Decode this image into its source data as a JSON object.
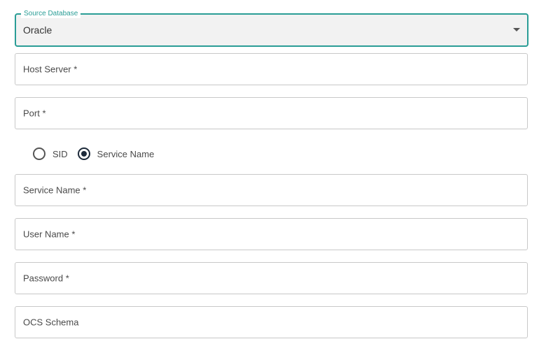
{
  "source_database": {
    "legend": "Source Database",
    "value": "Oracle"
  },
  "host_server": {
    "label": "Host Server *"
  },
  "port": {
    "label": "Port *"
  },
  "connection_type": {
    "options": [
      {
        "label": "SID",
        "selected": false
      },
      {
        "label": "Service Name",
        "selected": true
      }
    ]
  },
  "service_name": {
    "label": "Service Name *"
  },
  "user_name": {
    "label": "User Name *"
  },
  "password": {
    "label": "Password *"
  },
  "ocs_schema": {
    "label": "OCS Schema"
  },
  "colors": {
    "accent": "#2a9d96",
    "radio_selected": "#1d2a3a",
    "border": "#c8c8c8"
  },
  "icons": {
    "dropdown": "chevron-down-icon"
  }
}
